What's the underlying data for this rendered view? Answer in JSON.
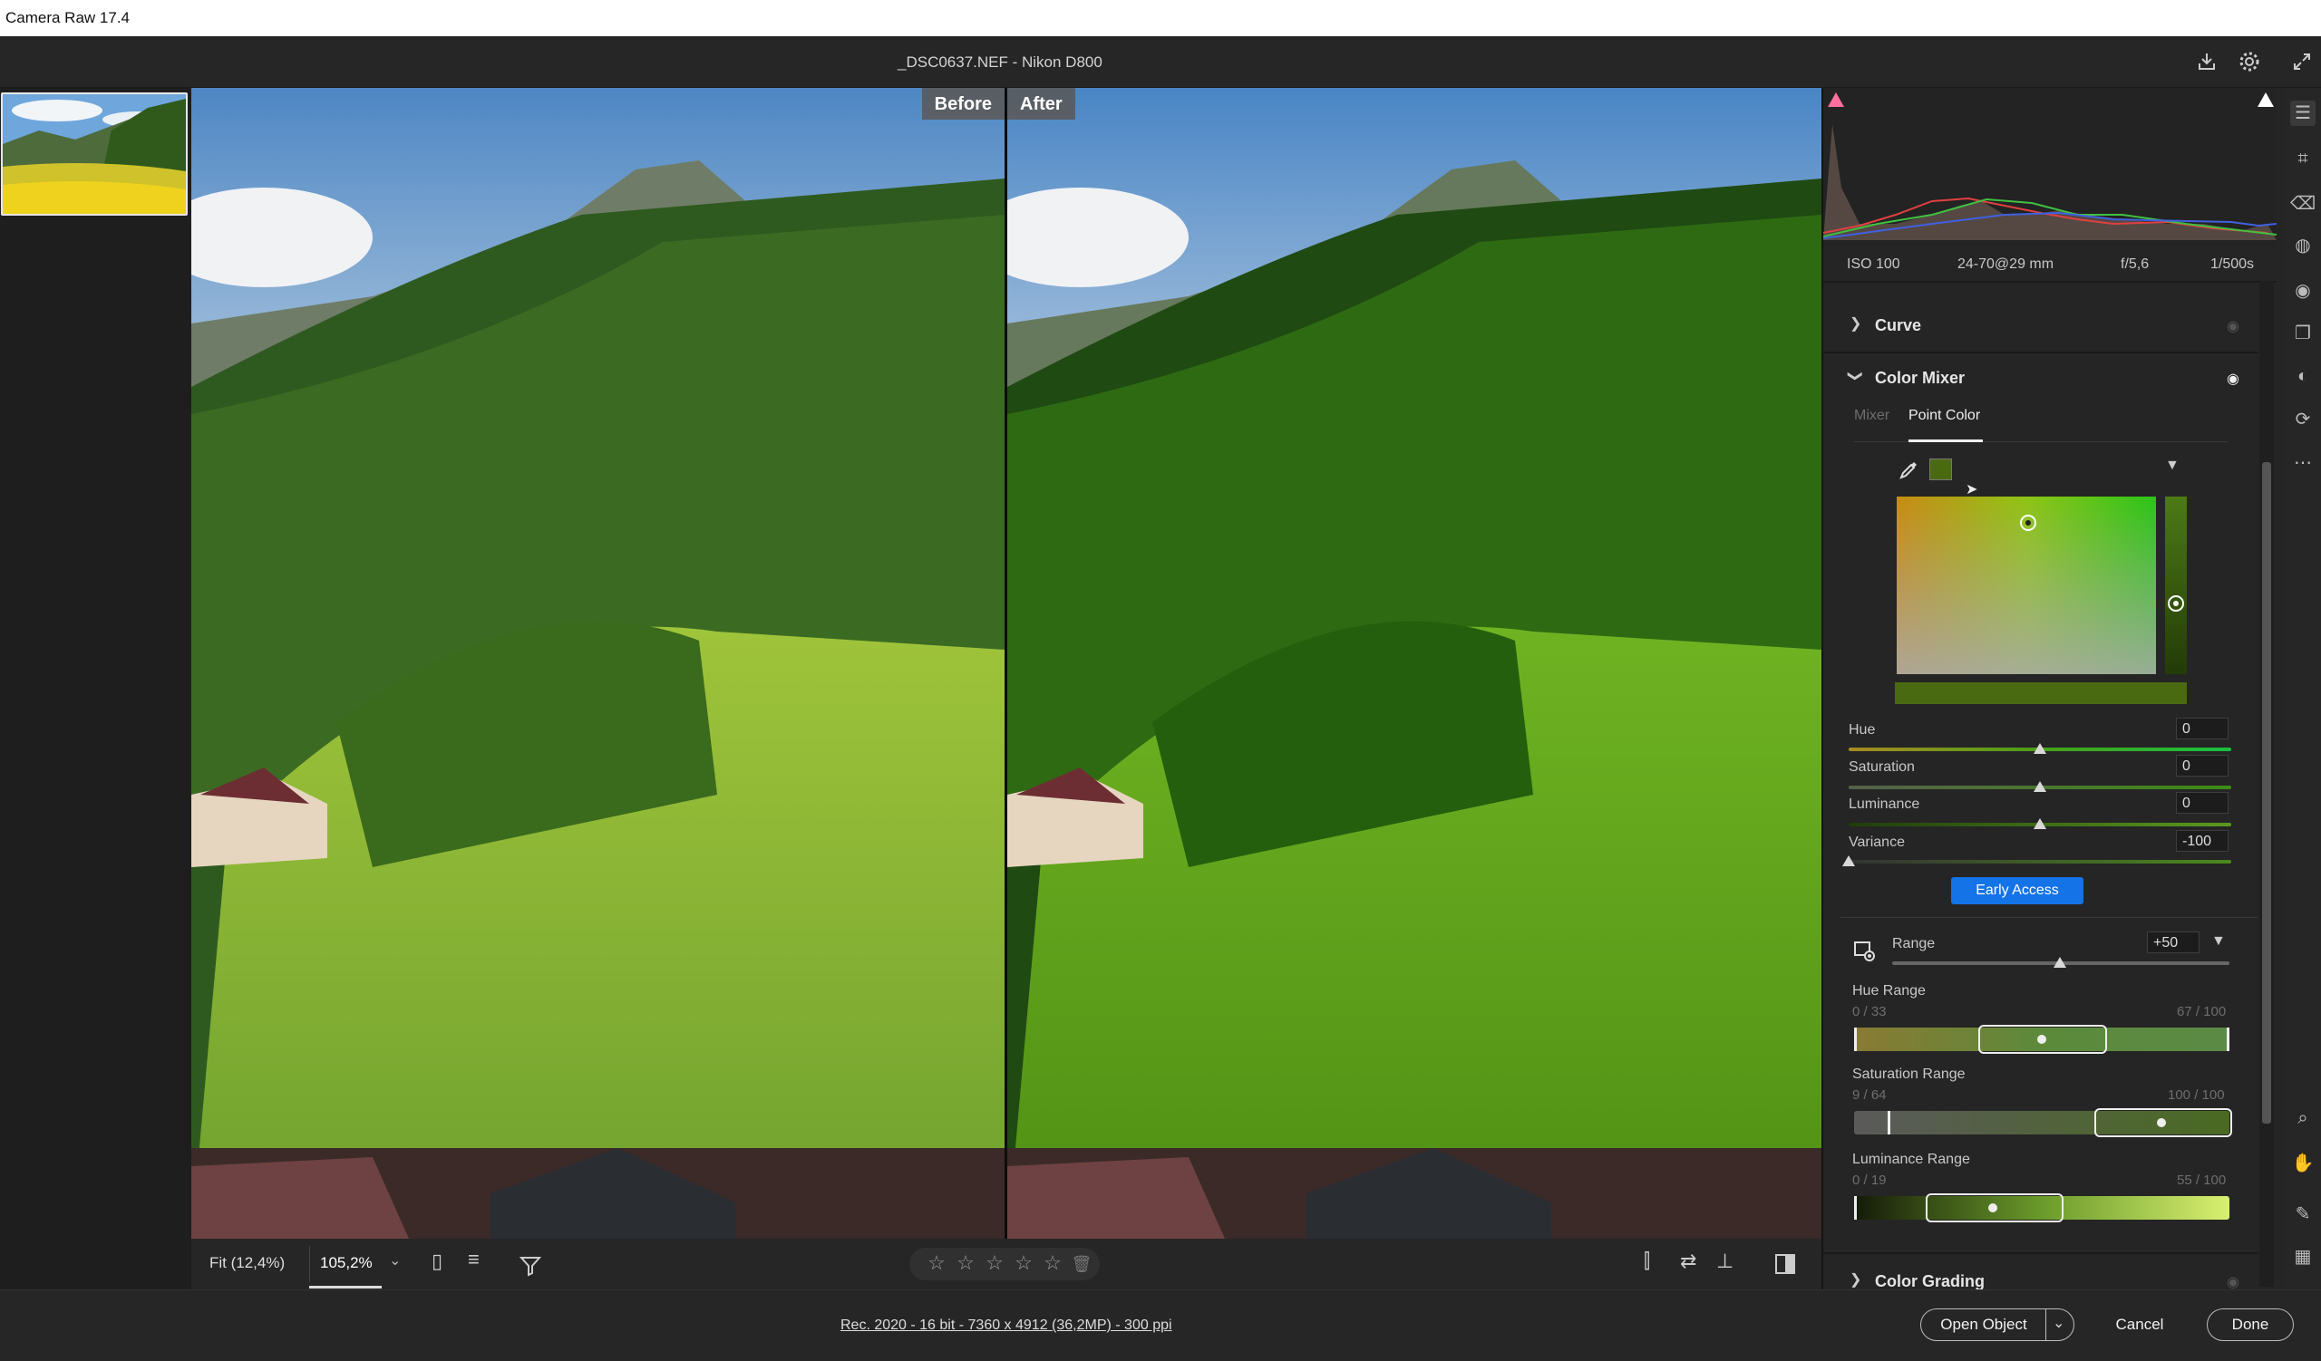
{
  "app": {
    "title": "Camera Raw 17.4"
  },
  "header": {
    "filename": "_DSC0637.NEF  -  Nikon D800"
  },
  "viewer": {
    "before_label": "Before",
    "after_label": "After"
  },
  "exif": {
    "iso": "ISO 100",
    "lens": "24-70@29 mm",
    "aperture": "f/5,6",
    "shutter": "1/500s"
  },
  "panels": {
    "curve": "Curve",
    "color_mixer": "Color Mixer",
    "color_grading": "Color Grading",
    "tabs": [
      "Mixer",
      "Point Color"
    ]
  },
  "point_color": {
    "sliders": [
      {
        "label": "Hue",
        "value": "0",
        "level": 0.5
      },
      {
        "label": "Saturation",
        "value": "0",
        "level": 0.5
      },
      {
        "label": "Luminance",
        "value": "0",
        "level": 0.5
      },
      {
        "label": "Variance",
        "value": "-100",
        "level": 0.0
      }
    ],
    "early_access": "Early Access",
    "range_label": "Range",
    "range_value": "+50",
    "hue_range": {
      "label": "Hue Range",
      "left": "0 / 33",
      "right": "67 / 100"
    },
    "sat_range": {
      "label": "Saturation Range",
      "left": "9 / 64",
      "right": "100 / 100"
    },
    "lum_range": {
      "label": "Luminance Range",
      "left": "0 / 19",
      "right": "55 / 100"
    },
    "sampled_color": "#4a6a12"
  },
  "bottom": {
    "fit": "Fit (12,4%)",
    "zoom": "105,2%",
    "rating": [
      "☆",
      "☆",
      "☆",
      "☆",
      "☆"
    ],
    "image_info": "Rec. 2020 - 16 bit - 7360 x 4912 (36,2MP) - 300 ppi"
  },
  "buttons": {
    "open": "Open Object",
    "cancel": "Cancel",
    "done": "Done"
  },
  "colors": {
    "accent": "#1473e6",
    "panel_bg": "#252525"
  }
}
